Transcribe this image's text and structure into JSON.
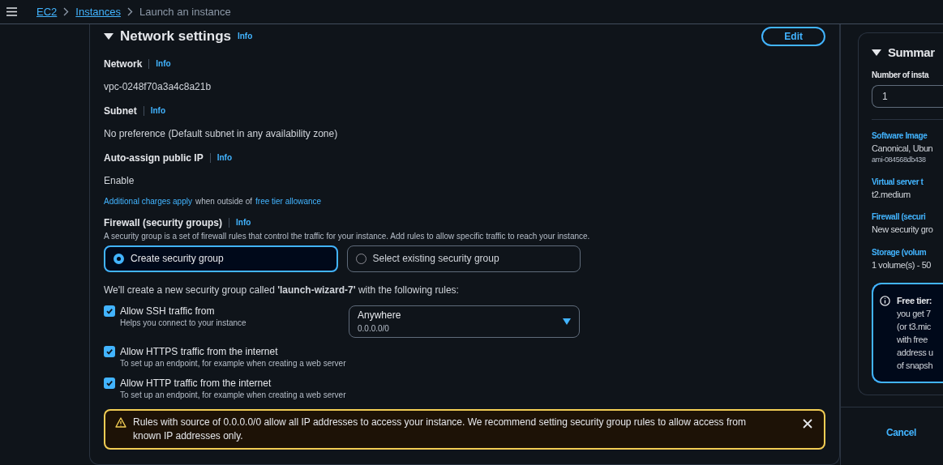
{
  "breadcrumbs": [
    {
      "label": "EC2",
      "link": true
    },
    {
      "label": "Instances",
      "link": true
    },
    {
      "label": "Launch an instance",
      "link": false
    }
  ],
  "section": {
    "title": "Network settings",
    "info": "Info",
    "expanded": true,
    "edit": "Edit",
    "fields": [
      {
        "label": "Network",
        "info": "Info",
        "value": "vpc-0248f70a3a4c8a21b"
      },
      {
        "label": "Subnet",
        "info": "Info",
        "value": "No preference (Default subnet in any availability zone)"
      },
      {
        "label": "Auto-assign public IP",
        "info": "Info",
        "value": "Enable"
      }
    ],
    "charges_note": {
      "link1": "Additional charges apply",
      "middle": "when outside of",
      "link2": "free tier allowance"
    },
    "firewall": {
      "label": "Firewall (security groups)",
      "info": "Info",
      "description": "A security group is a set of firewall rules that control the traffic for your instance. Add rules to allow specific traffic to reach your instance.",
      "options": [
        {
          "label": "Create security group",
          "selected": true
        },
        {
          "label": "Select existing security group",
          "selected": false
        }
      ],
      "create_note": "We'll create a new security group called **'launch-wizard-7'** with the following rules:",
      "rules": [
        {
          "label": "Allow SSH traffic from",
          "hint": "Helps you connect to your instance",
          "checked": true,
          "source": {
            "value": "Anywhere",
            "detail": "0.0.0.0/0"
          }
        },
        {
          "label": "Allow HTTPS traffic from the internet",
          "hint": "To set up an endpoint, for example when creating a web server",
          "checked": true
        },
        {
          "label": "Allow HTTP traffic from the internet",
          "hint": "To set up an endpoint, for example when creating a web server",
          "checked": true
        }
      ],
      "warning": "Rules with source of 0.0.0.0/0 allow all IP addresses to access your instance. We recommend setting security group rules to allow access from known IP addresses only."
    }
  },
  "summary": {
    "title": "Summar",
    "expanded": true,
    "count_label": "Number of insta",
    "count_value": "1",
    "items": [
      {
        "label": "Software Image",
        "lines": [
          "Canonical, Ubun",
          "ami-084568db438"
        ]
      },
      {
        "label": "Virtual server t",
        "lines": [
          "t2.medium"
        ]
      },
      {
        "label": "Firewall (securi",
        "lines": [
          "New security gro"
        ]
      },
      {
        "label": "Storage (volum",
        "lines": [
          "1 volume(s) - 50"
        ]
      }
    ],
    "free_tier": {
      "title": "Free tier:",
      "lines": [
        "you get 7",
        "(or t3.mic",
        "with free",
        "address u",
        "of snapsh"
      ]
    },
    "cancel": "Cancel"
  }
}
